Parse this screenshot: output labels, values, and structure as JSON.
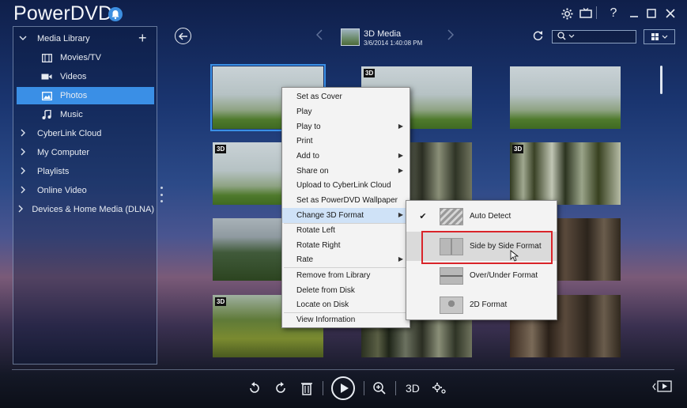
{
  "app": {
    "title": "PowerDVD"
  },
  "window_controls": {
    "minimize": "–",
    "maximize": "□",
    "close": "✕",
    "help": "?"
  },
  "sidebar": {
    "items": [
      {
        "label": "Media Library",
        "expanded": true
      },
      {
        "label": "Movies/TV"
      },
      {
        "label": "Videos"
      },
      {
        "label": "Photos",
        "active": true
      },
      {
        "label": "Music"
      },
      {
        "label": "CyberLink Cloud"
      },
      {
        "label": "My Computer"
      },
      {
        "label": "Playlists"
      },
      {
        "label": "Online Video"
      },
      {
        "label": "Devices & Home Media (DLNA)"
      }
    ],
    "add_label": "+"
  },
  "toolbar": {
    "media_title": "3D Media",
    "media_date": "3/6/2014 1:40:08 PM"
  },
  "photos": {
    "badge_3d": "3D"
  },
  "context_menu": {
    "items": [
      "Set as Cover",
      "Play",
      "Play to",
      "Print",
      "Add to",
      "Share on",
      "Upload to CyberLink Cloud",
      "Set as PowerDVD Wallpaper",
      "Change 3D Format",
      "Rotate Left",
      "Rotate Right",
      "Rate",
      "Remove from Library",
      "Delete from Disk",
      "Locate on Disk",
      "View Information"
    ]
  },
  "submenu": {
    "items": [
      {
        "label": "Auto Detect",
        "checked": true
      },
      {
        "label": "Side by Side Format",
        "highlighted": true
      },
      {
        "label": "Over/Under Format"
      },
      {
        "label": "2D Format"
      }
    ]
  },
  "bottom": {
    "label_3d": "3D"
  },
  "colors": {
    "accent": "#3a8fe6",
    "highlight_border": "#d9242a",
    "menu_bg": "#f3f3f3"
  }
}
